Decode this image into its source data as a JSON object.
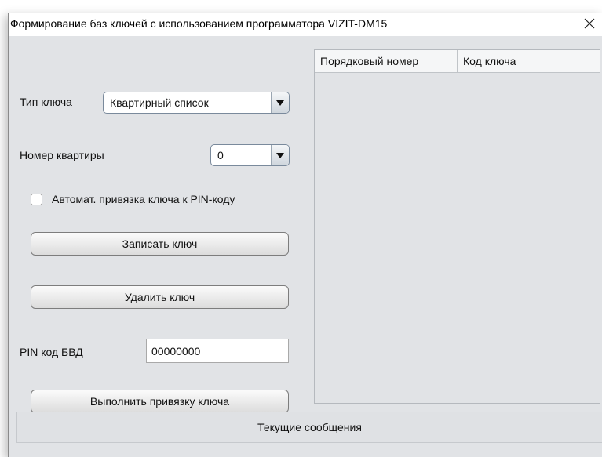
{
  "window": {
    "title": "Формирование баз ключей с использованием программатора VIZIT-DM15",
    "close_icon": "close-icon"
  },
  "form": {
    "key_type_label": "Тип ключа",
    "key_type_value": "Квартирный список",
    "apartment_label": "Номер квартиры",
    "apartment_value": "0",
    "auto_bind_label": "Автомат. привязка ключа к PIN-коду",
    "auto_bind_checked": false,
    "write_key_button": "Записать ключ",
    "delete_key_button": "Удалить ключ",
    "pin_label": "PIN код БВД",
    "pin_value": "00000000",
    "bind_key_button": "Выполнить привязку ключа"
  },
  "table": {
    "columns": [
      "Порядковый номер",
      "Код ключа"
    ],
    "rows": []
  },
  "messages": {
    "label": "Текущие сообщения"
  }
}
